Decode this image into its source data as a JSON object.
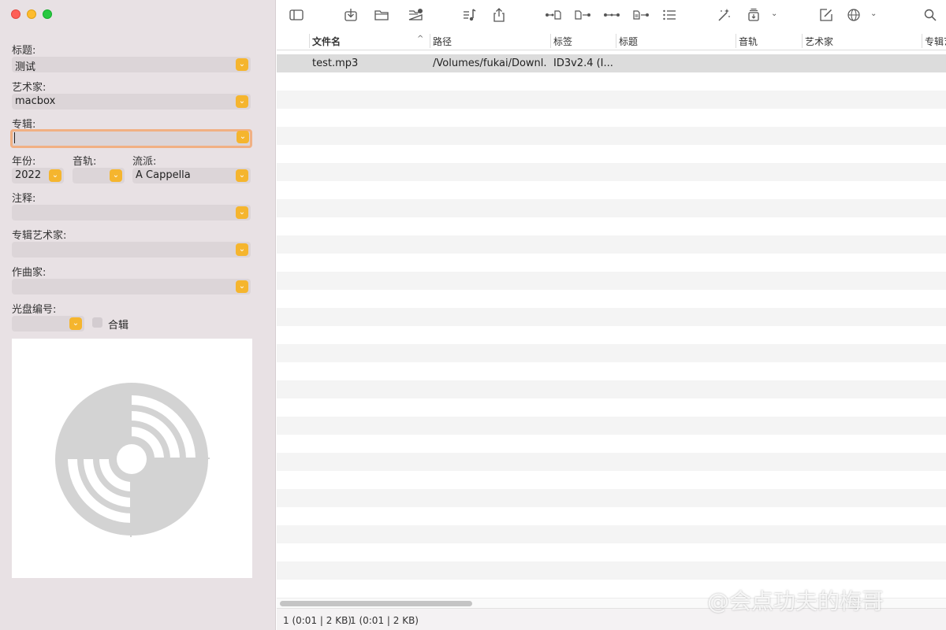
{
  "window": {
    "traffic_lights": [
      "close",
      "minimize",
      "zoom"
    ]
  },
  "sidebar": {
    "title_label": "标题:",
    "title_value": "测试",
    "artist_label": "艺术家:",
    "artist_value": "macbox",
    "album_label": "专辑:",
    "album_value": "",
    "year_label": "年份:",
    "year_value": "2022",
    "track_label": "音轨:",
    "track_value": "",
    "genre_label": "流派:",
    "genre_value": "A Cappella",
    "comment_label": "注释:",
    "comment_value": "",
    "album_artist_label": "专辑艺术家:",
    "album_artist_value": "",
    "composer_label": "作曲家:",
    "composer_value": "",
    "disc_label": "光盘编号:",
    "disc_value": "",
    "compilation_label": "合辑",
    "compilation_checked": false,
    "dropdown_icon": "chevron-down-icon",
    "artwork_icon": "disc-placeholder-icon"
  },
  "toolbar": {
    "icons": [
      "sidebar-toggle-icon",
      "import-icon",
      "open-folder-icon",
      "add-folder-icon",
      "music-note-icon",
      "share-icon",
      "tag-to-filename-icon",
      "filename-to-tag-icon",
      "tag-to-tag-icon",
      "text-to-tag-icon",
      "list-icon",
      "magic-wand-icon",
      "export-icon",
      "edit-icon",
      "globe-icon",
      "search-icon"
    ]
  },
  "table": {
    "columns": [
      "文件名",
      "路径",
      "标签",
      "标题",
      "音轨",
      "艺术家",
      "专辑艺"
    ],
    "sort_indicator": "^",
    "rows": [
      {
        "filename": "test.mp3",
        "path": "/Volumes/fukai/Downl...",
        "tag": "ID3v2.4 (I...",
        "title": "",
        "track": "",
        "artist": "",
        "album_artist": ""
      }
    ]
  },
  "status": {
    "left": "1 (0:01 | 2 KB)",
    "right": "1 (0:01 | 2 KB)"
  },
  "watermark": "@会点功夫的梅哥"
}
